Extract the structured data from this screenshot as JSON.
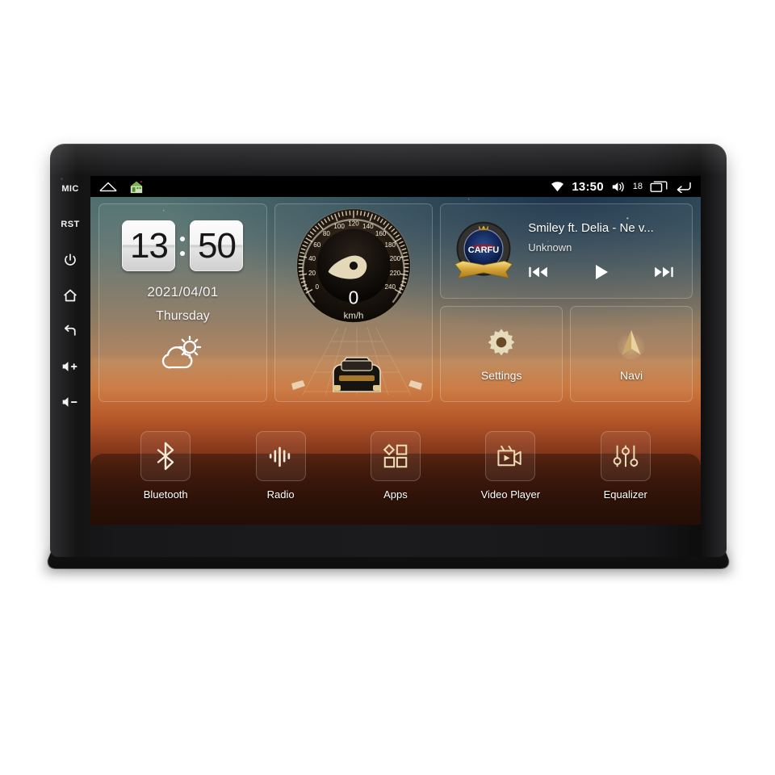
{
  "device": {
    "hardware_buttons": [
      {
        "name": "mic-label",
        "label": "MIC",
        "icon": "text"
      },
      {
        "name": "reset-label",
        "label": "RST",
        "icon": "text"
      },
      {
        "name": "power-button",
        "label": "",
        "icon": "power-icon"
      },
      {
        "name": "home-button",
        "label": "",
        "icon": "home-icon"
      },
      {
        "name": "back-button",
        "label": "",
        "icon": "back-icon"
      },
      {
        "name": "volume-up-button",
        "label": "",
        "icon": "volume-up-icon"
      },
      {
        "name": "volume-down-button",
        "label": "",
        "icon": "volume-down-icon"
      }
    ]
  },
  "status_bar": {
    "left_icons": [
      "navbar-home-outline-icon",
      "launcher-house-icon"
    ],
    "wifi_icon": "wifi-icon",
    "time": "13:50",
    "volume_icon": "volume-icon",
    "volume_level": "18",
    "recents_icon": "recents-icon",
    "back_icon": "back-icon"
  },
  "clock_widget": {
    "hours": "13",
    "minutes": "50",
    "date": "2021/04/01",
    "weekday": "Thursday",
    "weather_icon": "partly-cloudy-icon"
  },
  "speedometer_widget": {
    "value": "0",
    "unit": "km/h",
    "ticks": [
      "0",
      "20",
      "40",
      "60",
      "80",
      "100",
      "120",
      "140",
      "160",
      "180",
      "200",
      "220",
      "240"
    ],
    "min": 0,
    "max": 240
  },
  "media_widget": {
    "album_art": "carfu-badge",
    "album_art_text": "CARFU",
    "title": "Smiley ft. Delia - Ne v...",
    "artist": "Unknown",
    "controls": [
      {
        "name": "previous-track-button",
        "icon": "skip-previous-icon"
      },
      {
        "name": "play-button",
        "icon": "play-icon"
      },
      {
        "name": "next-track-button",
        "icon": "skip-next-icon"
      }
    ]
  },
  "tiles": [
    {
      "name": "settings-tile",
      "label": "Settings",
      "icon": "gear-icon"
    },
    {
      "name": "navi-tile",
      "label": "Navi",
      "icon": "navigation-arrow-icon"
    }
  ],
  "dock": [
    {
      "name": "dock-item-bluetooth",
      "label": "Bluetooth",
      "icon": "bluetooth-icon"
    },
    {
      "name": "dock-item-radio",
      "label": "Radio",
      "icon": "radio-waveform-icon"
    },
    {
      "name": "dock-item-apps",
      "label": "Apps",
      "icon": "apps-grid-icon"
    },
    {
      "name": "dock-item-video-player",
      "label": "Video Player",
      "icon": "video-camera-icon"
    },
    {
      "name": "dock-item-equalizer",
      "label": "Equalizer",
      "icon": "equalizer-sliders-icon"
    }
  ],
  "colors": {
    "accent_gold": "#e8d5a8",
    "status_bar_bg": "#000000",
    "wallpaper_top": "#4b6a6c",
    "wallpaper_mid": "#c4763f",
    "wallpaper_bottom": "#241009"
  }
}
